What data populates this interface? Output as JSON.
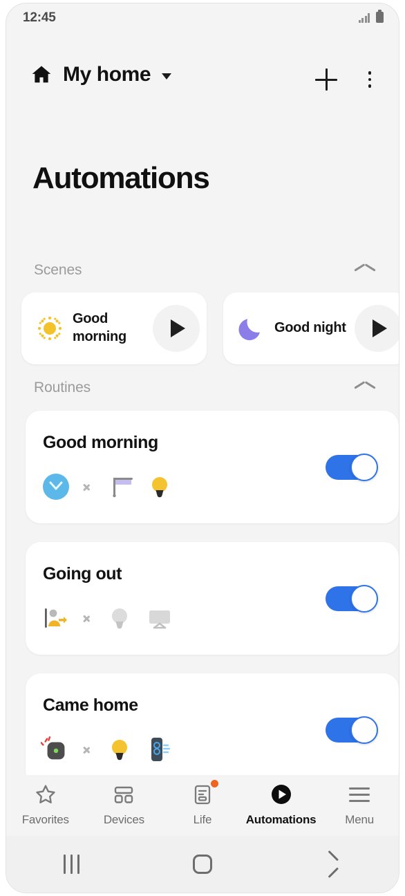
{
  "status_bar": {
    "time": "12:45",
    "signal_icon": "signal-bars-icon",
    "battery_icon": "battery-icon"
  },
  "app_bar": {
    "home_icon": "home-icon",
    "home_name": "My home",
    "dropdown_icon": "chevron-down-icon",
    "add_icon": "plus-icon",
    "more_icon": "more-vertical-icon"
  },
  "page": {
    "title": "Automations"
  },
  "sections": {
    "scenes": {
      "label": "Scenes",
      "collapse_icon": "chevron-up-icon"
    },
    "routines": {
      "label": "Routines",
      "collapse_icon": "chevron-up-icon"
    }
  },
  "scenes": [
    {
      "label": "Good morning",
      "icon": "sun-icon",
      "icon_color": "#f3c32c",
      "play_icon": "play-icon"
    },
    {
      "label": "Good night",
      "icon": "moon-icon",
      "icon_color": "#8b7ee8",
      "play_icon": "play-icon"
    }
  ],
  "routines": [
    {
      "title": "Good morning",
      "toggle_on": true,
      "trigger_icon": "clock-icon",
      "arrow_icon": "chevron-right-icon",
      "action_icons": [
        "blind-icon",
        "light-bulb-on-icon"
      ]
    },
    {
      "title": "Going out",
      "toggle_on": true,
      "trigger_icon": "person-leaving-icon",
      "arrow_icon": "chevron-right-icon",
      "action_icons": [
        "light-bulb-off-icon",
        "tv-icon"
      ]
    },
    {
      "title": "Came home",
      "toggle_on": true,
      "trigger_icon": "motion-sensor-icon",
      "arrow_icon": "chevron-right-icon",
      "action_icons": [
        "light-bulb-on-icon",
        "air-purifier-icon"
      ]
    }
  ],
  "tabs": [
    {
      "label": "Favorites",
      "icon": "star-icon",
      "active": false,
      "badge": false
    },
    {
      "label": "Devices",
      "icon": "grid-icon",
      "active": false,
      "badge": false
    },
    {
      "label": "Life",
      "icon": "document-icon",
      "active": false,
      "badge": true
    },
    {
      "label": "Automations",
      "icon": "play-circle-icon",
      "active": true,
      "badge": false
    },
    {
      "label": "Menu",
      "icon": "hamburger-icon",
      "active": false,
      "badge": false
    }
  ],
  "nav_bar": {
    "recents_icon": "recents-icon",
    "home_icon": "home-square-icon",
    "back_icon": "back-chevron-icon"
  },
  "colors": {
    "toggle_on": "#2f73e8",
    "badge": "#ee6420",
    "background": "#f4f4f4",
    "card": "#ffffff"
  }
}
